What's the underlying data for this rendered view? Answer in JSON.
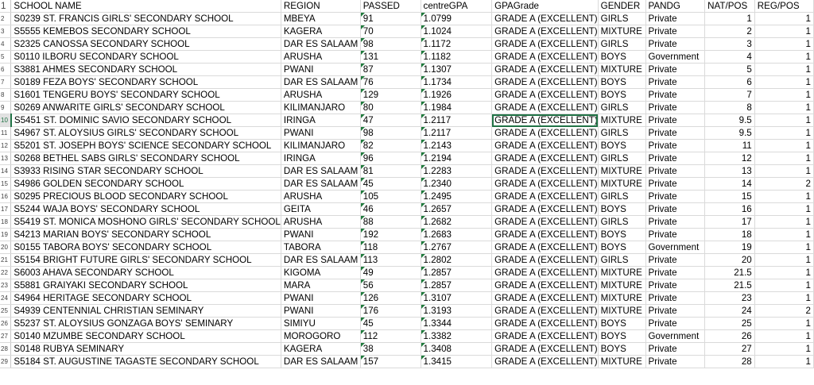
{
  "columns": [
    "SCHOOL NAME",
    "REGION",
    "PASSED",
    "centreGPA",
    "GPAGrade",
    "GENDER",
    "PANDG",
    "NAT/POS",
    "REG/POS"
  ],
  "first_row_number": "1",
  "rows": [
    {
      "num": "2",
      "school": "S0239 ST. FRANCIS GIRLS' SECONDARY SCHOOL",
      "region": "MBEYA",
      "passed": "91",
      "gpa": "1.0799",
      "grade": "GRADE A (EXCELLENT)",
      "gender": "GIRLS",
      "pandg": "Private",
      "natpos": "1",
      "regpos": "1"
    },
    {
      "num": "3",
      "school": "S5555 KEMEBOS SECONDARY SCHOOL",
      "region": "KAGERA",
      "passed": "70",
      "gpa": "1.1024",
      "grade": "GRADE A (EXCELLENT)",
      "gender": "MIXTURE",
      "pandg": "Private",
      "natpos": "2",
      "regpos": "1"
    },
    {
      "num": "4",
      "school": "S2325 CANOSSA SECONDARY SCHOOL",
      "region": "DAR ES SALAAM",
      "passed": "98",
      "gpa": "1.1172",
      "grade": "GRADE A (EXCELLENT)",
      "gender": "GIRLS",
      "pandg": "Private",
      "natpos": "3",
      "regpos": "1"
    },
    {
      "num": "5",
      "school": "S0110 ILBORU SECONDARY SCHOOL",
      "region": "ARUSHA",
      "passed": "131",
      "gpa": "1.1182",
      "grade": "GRADE A (EXCELLENT)",
      "gender": "BOYS",
      "pandg": "Government",
      "natpos": "4",
      "regpos": "1"
    },
    {
      "num": "6",
      "school": "S3881 AHMES SECONDARY SCHOOL",
      "region": "PWANI",
      "passed": "87",
      "gpa": "1.1307",
      "grade": "GRADE A (EXCELLENT)",
      "gender": "MIXTURE",
      "pandg": "Private",
      "natpos": "5",
      "regpos": "1"
    },
    {
      "num": "7",
      "school": "S0189 FEZA BOYS' SECONDARY SCHOOL",
      "region": "DAR ES SALAAM",
      "passed": "76",
      "gpa": "1.1734",
      "grade": "GRADE A (EXCELLENT)",
      "gender": "BOYS",
      "pandg": "Private",
      "natpos": "6",
      "regpos": "1"
    },
    {
      "num": "8",
      "school": "S1601 TENGERU BOYS' SECONDARY SCHOOL",
      "region": "ARUSHA",
      "passed": "129",
      "gpa": "1.1926",
      "grade": "GRADE A (EXCELLENT)",
      "gender": "BOYS",
      "pandg": "Private",
      "natpos": "7",
      "regpos": "1"
    },
    {
      "num": "9",
      "school": "S0269 ANWARITE GIRLS' SECONDARY SCHOOL",
      "region": "KILIMANJARO",
      "passed": "80",
      "gpa": "1.1984",
      "grade": "GRADE A (EXCELLENT)",
      "gender": "GIRLS",
      "pandg": "Private",
      "natpos": "8",
      "regpos": "1"
    },
    {
      "num": "10",
      "school": "S5451 ST. DOMINIC SAVIO SECONDARY SCHOOL",
      "region": "IRINGA",
      "passed": "47",
      "gpa": "1.2117",
      "grade": "GRADE A (EXCELLENT)",
      "gender": "MIXTURE",
      "pandg": "Private",
      "natpos": "9.5",
      "regpos": "1"
    },
    {
      "num": "11",
      "school": "S4967 ST. ALOYSIUS GIRLS' SECONDARY SCHOOL",
      "region": "PWANI",
      "passed": "98",
      "gpa": "1.2117",
      "grade": "GRADE A (EXCELLENT)",
      "gender": "GIRLS",
      "pandg": "Private",
      "natpos": "9.5",
      "regpos": "1"
    },
    {
      "num": "12",
      "school": "S5201 ST. JOSEPH BOYS' SCIENCE SECONDARY SCHOOL",
      "region": "KILIMANJARO",
      "passed": "82",
      "gpa": "1.2143",
      "grade": "GRADE A (EXCELLENT)",
      "gender": "BOYS",
      "pandg": "Private",
      "natpos": "11",
      "regpos": "1"
    },
    {
      "num": "13",
      "school": "S0268 BETHEL SABS GIRLS' SECONDARY SCHOOL",
      "region": "IRINGA",
      "passed": "96",
      "gpa": "1.2194",
      "grade": "GRADE A (EXCELLENT)",
      "gender": "GIRLS",
      "pandg": "Private",
      "natpos": "12",
      "regpos": "1"
    },
    {
      "num": "14",
      "school": "S3933 RISING STAR SECONDARY SCHOOL",
      "region": "DAR ES SALAAM",
      "passed": "81",
      "gpa": "1.2283",
      "grade": "GRADE A (EXCELLENT)",
      "gender": "MIXTURE",
      "pandg": "Private",
      "natpos": "13",
      "regpos": "1"
    },
    {
      "num": "15",
      "school": "S4986 GOLDEN SECONDARY SCHOOL",
      "region": "DAR ES SALAAM",
      "passed": "45",
      "gpa": "1.2340",
      "grade": "GRADE A (EXCELLENT)",
      "gender": "MIXTURE",
      "pandg": "Private",
      "natpos": "14",
      "regpos": "2"
    },
    {
      "num": "16",
      "school": "S0295 PRECIOUS BLOOD SECONDARY SCHOOL",
      "region": "ARUSHA",
      "passed": "105",
      "gpa": "1.2495",
      "grade": "GRADE A (EXCELLENT)",
      "gender": "GIRLS",
      "pandg": "Private",
      "natpos": "15",
      "regpos": "1"
    },
    {
      "num": "17",
      "school": "S5244 WAJA BOYS' SECONDARY SCHOOL",
      "region": "GEITA",
      "passed": "46",
      "gpa": "1.2657",
      "grade": "GRADE A (EXCELLENT)",
      "gender": "BOYS",
      "pandg": "Private",
      "natpos": "16",
      "regpos": "1"
    },
    {
      "num": "18",
      "school": "S5419 ST. MONICA MOSHONO GIRLS' SECONDARY SCHOOL",
      "region": "ARUSHA",
      "passed": "88",
      "gpa": "1.2682",
      "grade": "GRADE A (EXCELLENT)",
      "gender": "GIRLS",
      "pandg": "Private",
      "natpos": "17",
      "regpos": "1"
    },
    {
      "num": "19",
      "school": "S4213 MARIAN BOYS' SECONDARY SCHOOL",
      "region": "PWANI",
      "passed": "192",
      "gpa": "1.2683",
      "grade": "GRADE A (EXCELLENT)",
      "gender": "BOYS",
      "pandg": "Private",
      "natpos": "18",
      "regpos": "1"
    },
    {
      "num": "20",
      "school": "S0155 TABORA BOYS' SECONDARY SCHOOL",
      "region": "TABORA",
      "passed": "118",
      "gpa": "1.2767",
      "grade": "GRADE A (EXCELLENT)",
      "gender": "BOYS",
      "pandg": "Government",
      "natpos": "19",
      "regpos": "1"
    },
    {
      "num": "21",
      "school": "S5154 BRIGHT FUTURE GIRLS' SECONDARY SCHOOL",
      "region": "DAR ES SALAAM",
      "passed": "113",
      "gpa": "1.2802",
      "grade": "GRADE A (EXCELLENT)",
      "gender": "GIRLS",
      "pandg": "Private",
      "natpos": "20",
      "regpos": "1"
    },
    {
      "num": "22",
      "school": "S6003 AHAVA SECONDARY SCHOOL",
      "region": "KIGOMA",
      "passed": "49",
      "gpa": "1.2857",
      "grade": "GRADE A (EXCELLENT)",
      "gender": "MIXTURE",
      "pandg": "Private",
      "natpos": "21.5",
      "regpos": "1"
    },
    {
      "num": "23",
      "school": "S5881 GRAIYAKI SECONDARY SCHOOL",
      "region": "MARA",
      "passed": "56",
      "gpa": "1.2857",
      "grade": "GRADE A (EXCELLENT)",
      "gender": "MIXTURE",
      "pandg": "Private",
      "natpos": "21.5",
      "regpos": "1"
    },
    {
      "num": "24",
      "school": "S4964 HERITAGE SECONDARY SCHOOL",
      "region": "PWANI",
      "passed": "126",
      "gpa": "1.3107",
      "grade": "GRADE A (EXCELLENT)",
      "gender": "MIXTURE",
      "pandg": "Private",
      "natpos": "23",
      "regpos": "1"
    },
    {
      "num": "25",
      "school": "S4939 CENTENNIAL CHRISTIAN SEMINARY",
      "region": "PWANI",
      "passed": "176",
      "gpa": "1.3193",
      "grade": "GRADE A (EXCELLENT)",
      "gender": "MIXTURE",
      "pandg": "Private",
      "natpos": "24",
      "regpos": "2"
    },
    {
      "num": "26",
      "school": "S5237 ST. ALOYSIUS GONZAGA BOYS' SEMINARY",
      "region": "SIMIYU",
      "passed": "45",
      "gpa": "1.3344",
      "grade": "GRADE A (EXCELLENT)",
      "gender": "BOYS",
      "pandg": "Private",
      "natpos": "25",
      "regpos": "1"
    },
    {
      "num": "27",
      "school": "S0140 MZUMBE SECONDARY SCHOOL",
      "region": "MOROGORO",
      "passed": "112",
      "gpa": "1.3382",
      "grade": "GRADE A (EXCELLENT)",
      "gender": "BOYS",
      "pandg": "Government",
      "natpos": "26",
      "regpos": "1"
    },
    {
      "num": "28",
      "school": "S0148 RUBYA SEMINARY",
      "region": "KAGERA",
      "passed": "38",
      "gpa": "1.3408",
      "grade": "GRADE A (EXCELLENT)",
      "gender": "BOYS",
      "pandg": "Private",
      "natpos": "27",
      "regpos": "1"
    },
    {
      "num": "29",
      "school": "S5184 ST. AUGUSTINE TAGASTE SECONDARY SCHOOL",
      "region": "DAR ES SALAAM",
      "passed": "157",
      "gpa": "1.3415",
      "grade": "GRADE A (EXCELLENT)",
      "gender": "MIXTURE",
      "pandg": "Private",
      "natpos": "28",
      "regpos": "1"
    }
  ],
  "selection": {
    "row_number": "10",
    "column": "GPAGrade"
  },
  "colors": {
    "grid": "#dadada",
    "selection": "#217346",
    "error_flag": "#1f7a3c"
  }
}
